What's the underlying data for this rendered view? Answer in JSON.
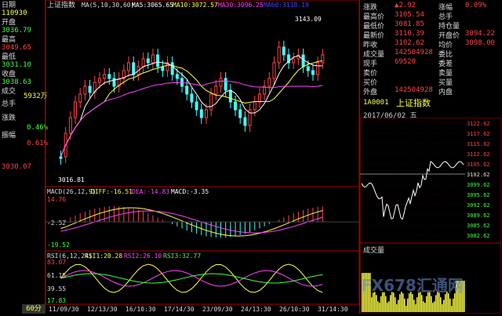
{
  "left_panel": {
    "items": [
      {
        "label": "日期",
        "value": "110930",
        "cls": "val"
      },
      {
        "label": "开盘",
        "value": "3036.79",
        "cls": "valg"
      },
      {
        "label": "最高",
        "value": "3049.65",
        "cls": "valr"
      },
      {
        "label": "最低",
        "value": "3031.10",
        "cls": "valg"
      },
      {
        "label": "收盘",
        "value": "3038.63",
        "cls": "valg"
      },
      {
        "label": "成交",
        "value": "5932万",
        "cls": "val"
      },
      {
        "label": "总手",
        "value": "",
        "cls": "val"
      },
      {
        "label": "涨跌",
        "value": "0.46%",
        "cls": "valg"
      },
      {
        "label": "振幅",
        "value": "0.61%",
        "cls": "valr"
      }
    ]
  },
  "main_header": {
    "title": "上证指数",
    "ma_params": "MA(5,10,30,60)",
    "ma5": "MA5:3065.65",
    "ma10": "MA10:3072.57",
    "ma30": "MA30:3096.25",
    "ma60": "MA60:3118.19"
  },
  "main_chart": {
    "high_label": "3143.09",
    "low_label": "3016.81",
    "left_axis_label": "3030.07"
  },
  "macd": {
    "header": "MACD(26,12,9)",
    "diff": "DIFF:-16.51",
    "dea": "DEA:-14.83",
    "macd": "MACD:-3.35",
    "axis": [
      "14.76",
      "-2.52",
      "-19.52"
    ]
  },
  "rsi": {
    "header": "RSI(6,12,24)",
    "rsi1": "RSI1:20.28",
    "rsi2": "RSI2:26.10",
    "rsi3": "RSI3:32.77",
    "axis": [
      "83.07",
      "61.15",
      "39.55",
      "17.83"
    ]
  },
  "time_axis": [
    "11/09/30",
    "12/13/30",
    "16/10:30",
    "17/14/30",
    "23/09/30",
    "24/13:30",
    "26/10:30",
    "31/14:30"
  ],
  "period": "60分",
  "right_panel": {
    "rows": [
      {
        "l": "涨跌",
        "v": "▲2.92",
        "l2": "涨幅",
        "v2": "0.09%"
      },
      {
        "l": "最高价",
        "v": "3105.54",
        "l2": "总手",
        "v2": ""
      },
      {
        "l": "最低价",
        "v": "3081.85",
        "l2": "持仓量",
        "v2": ""
      },
      {
        "l": "最新价",
        "v": "3110.39",
        "l2": "开盘价",
        "v2": "3094.22"
      },
      {
        "l": "昨收",
        "v": "3102.62",
        "l2": "均价",
        "v2": "3098.00"
      },
      {
        "l": "成交量",
        "v": "142504928",
        "l2": "委比",
        "v2": ""
      },
      {
        "l": "现手",
        "v": "69520",
        "l2": "委差",
        "v2": ""
      },
      {
        "l": "卖价",
        "v": "",
        "l2": "卖量",
        "v2": ""
      },
      {
        "l": "买价",
        "v": "",
        "l2": "买量",
        "v2": ""
      },
      {
        "l": "外盘",
        "v": "142504928",
        "l2": "内盘",
        "v2": ""
      }
    ],
    "code": "1A0001",
    "name": "上证指数",
    "date": "2017/06/02 五",
    "price_axis": [
      "3122.62",
      "3117.62",
      "3115.62",
      "3112.62",
      "3105.62",
      "3102.62",
      "3099.62",
      "3095.62",
      "3092.62",
      "3089.62",
      "3085.62",
      "3082.62"
    ],
    "volume_label": "成交量"
  },
  "watermark": "FX678汇通网"
}
